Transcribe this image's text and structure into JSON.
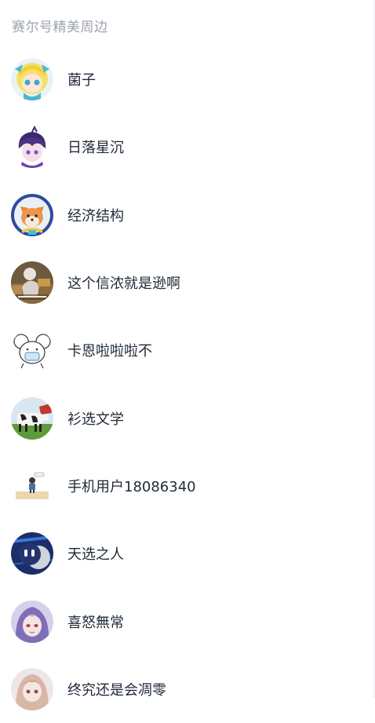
{
  "section": {
    "title": "赛尔号精美周边"
  },
  "members": [
    {
      "name": "菌子",
      "avatar_icon": "anime-girl-yellow-hair-avatar"
    },
    {
      "name": "日落星沉",
      "avatar_icon": "anime-chibi-purple-avatar"
    },
    {
      "name": "经济结构",
      "avatar_icon": "shiba-dog-avatar"
    },
    {
      "name": "这个信浓就是逊啊",
      "avatar_icon": "anime-scene-avatar"
    },
    {
      "name": "卡恩啦啦啦不",
      "avatar_icon": "sketch-mouse-avatar"
    },
    {
      "name": "衫选文学",
      "avatar_icon": "cow-avatar"
    },
    {
      "name": "手机用户18086340",
      "avatar_icon": "small-pixel-figure-avatar"
    },
    {
      "name": "天选之人",
      "avatar_icon": "robot-avatar"
    },
    {
      "name": "喜怒無常",
      "avatar_icon": "anime-purple-hair-avatar"
    },
    {
      "name": "终究还是会凋零",
      "avatar_icon": "anime-pink-hair-avatar"
    }
  ]
}
